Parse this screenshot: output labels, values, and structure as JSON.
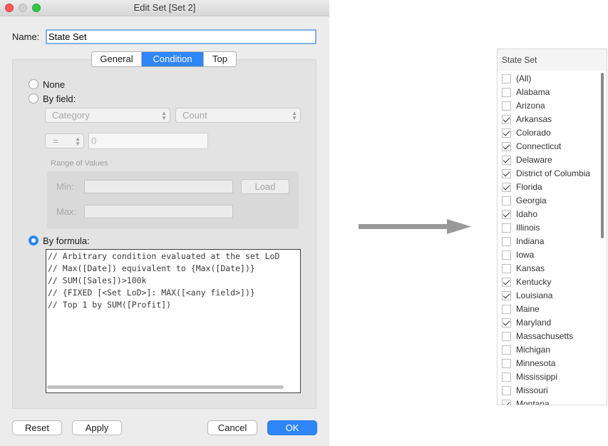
{
  "dialog": {
    "title": "Edit Set [Set 2]",
    "name_label": "Name:",
    "name_value": "State Set",
    "tabs": [
      {
        "label": "General"
      },
      {
        "label": "Condition",
        "selected": true
      },
      {
        "label": "Top"
      }
    ],
    "condition": {
      "none_label": "None",
      "by_field_label": "By field:",
      "field_select": "Category",
      "aggregation_select": "Count",
      "operator_select": "=",
      "value_input": "0",
      "range_of_values_label": "Range of Values",
      "min_label": "Min:",
      "max_label": "Max:",
      "load_button": "Load",
      "by_formula_label": "By formula:",
      "selected_option": "By formula",
      "formula_lines": [
        "// Arbitrary condition evaluated at the set LoD",
        "// Max([Date]) equivalent to {Max([Date])}",
        "// SUM([Sales])>100k",
        "// {FIXED [<Set LoD>]: MAX([<any field>])}",
        "// Top 1 by SUM([Profit])"
      ]
    },
    "buttons": {
      "reset": "Reset",
      "apply": "Apply",
      "cancel": "Cancel",
      "ok": "OK"
    }
  },
  "state_set": {
    "title": "State Set",
    "items": [
      {
        "label": "(All)",
        "checked": false
      },
      {
        "label": "Alabama",
        "checked": false
      },
      {
        "label": "Arizona",
        "checked": false
      },
      {
        "label": "Arkansas",
        "checked": true
      },
      {
        "label": "Colorado",
        "checked": true
      },
      {
        "label": "Connecticut",
        "checked": true
      },
      {
        "label": "Delaware",
        "checked": true
      },
      {
        "label": "District of Columbia",
        "checked": true
      },
      {
        "label": "Florida",
        "checked": true
      },
      {
        "label": "Georgia",
        "checked": false
      },
      {
        "label": "Idaho",
        "checked": true
      },
      {
        "label": "Illinois",
        "checked": false
      },
      {
        "label": "Indiana",
        "checked": false
      },
      {
        "label": "Iowa",
        "checked": false
      },
      {
        "label": "Kansas",
        "checked": false
      },
      {
        "label": "Kentucky",
        "checked": true
      },
      {
        "label": "Louisiana",
        "checked": true
      },
      {
        "label": "Maine",
        "checked": false
      },
      {
        "label": "Maryland",
        "checked": true
      },
      {
        "label": "Massachusetts",
        "checked": false
      },
      {
        "label": "Michigan",
        "checked": false
      },
      {
        "label": "Minnesota",
        "checked": false
      },
      {
        "label": "Mississippi",
        "checked": false
      },
      {
        "label": "Missouri",
        "checked": false
      },
      {
        "label": "Montana",
        "checked": true
      }
    ]
  },
  "colors": {
    "accent": "#2f86f6",
    "close": "#fc5b57",
    "maximize": "#33c748",
    "arrow": "#999999"
  }
}
